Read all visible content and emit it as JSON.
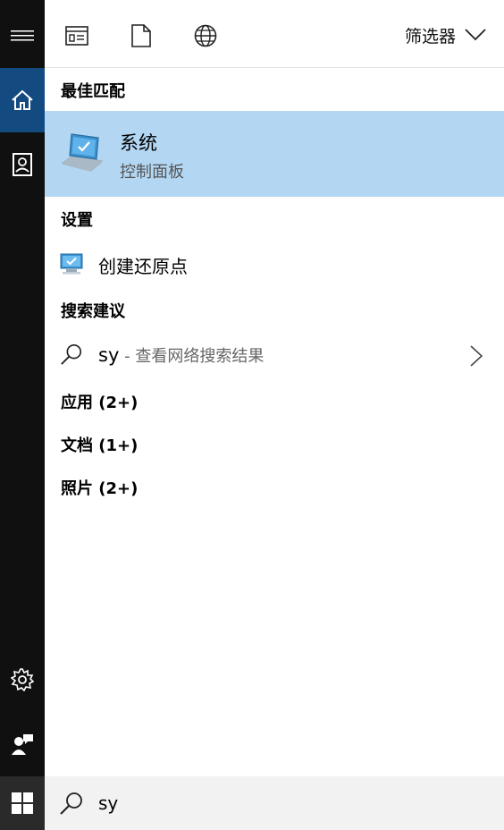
{
  "toolbar": {
    "filter_label": "筛选器"
  },
  "sections": {
    "best_match": "最佳匹配",
    "settings": "设置",
    "suggestions": "搜索建议",
    "apps": "应用 (2+)",
    "documents": "文档 (1+)",
    "photos": "照片 (2+)"
  },
  "best_match": {
    "title": "系统",
    "subtitle": "控制面板"
  },
  "settings_items": [
    {
      "label": "创建还原点"
    }
  ],
  "suggestion": {
    "query": "sy",
    "separator": " - ",
    "description": "查看网络搜索结果"
  },
  "search": {
    "value": "sy"
  },
  "icons": {
    "rail": [
      "hamburger-menu-icon",
      "home-icon",
      "notebook-icon",
      "settings-gear-icon",
      "feedback-person-icon",
      "windows-logo-icon"
    ],
    "toolbar": [
      "apps-filter-icon",
      "documents-filter-icon",
      "web-filter-icon",
      "chevron-down-icon"
    ]
  },
  "colors": {
    "rail_bg": "#101010",
    "rail_active": "#134a80",
    "best_match_bg": "#b3d7f3",
    "searchbar_bg": "#f2f2f2"
  }
}
